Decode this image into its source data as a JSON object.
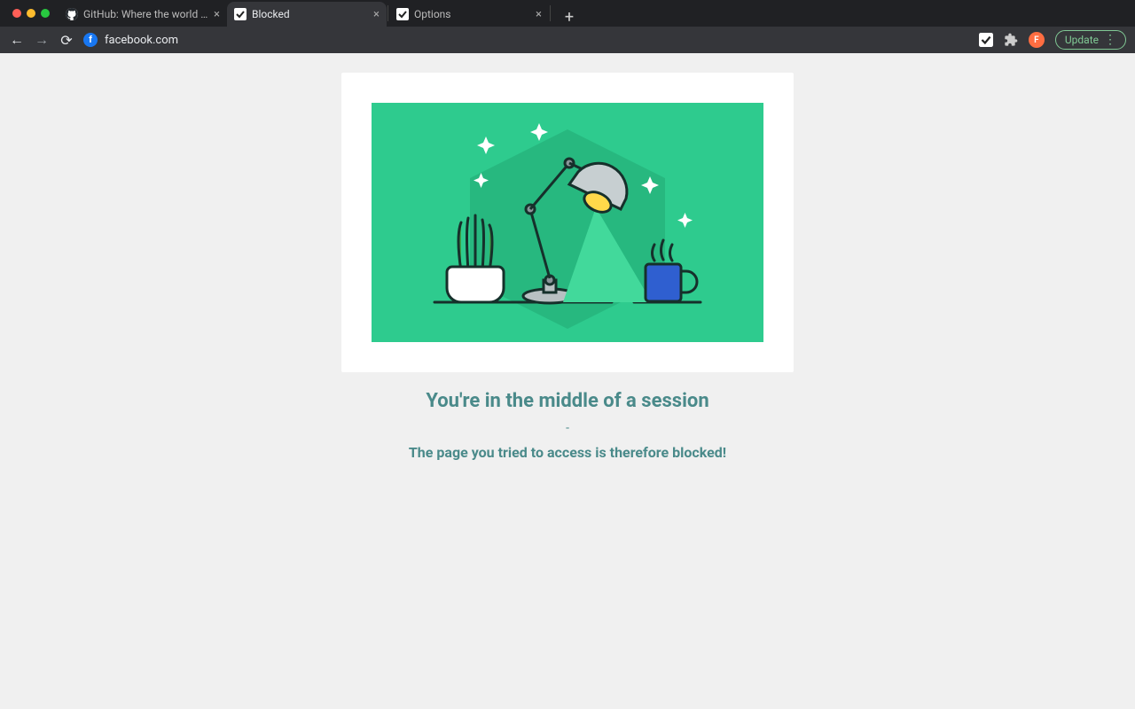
{
  "browser": {
    "tabs": [
      {
        "title": "GitHub: Where the world build…",
        "active": false,
        "favicon": "github"
      },
      {
        "title": "Blocked",
        "active": true,
        "favicon": "ext"
      },
      {
        "title": "Options",
        "active": false,
        "favicon": "ext"
      }
    ],
    "address": "facebook.com",
    "site_badge_letter": "f",
    "profile_letter": "F",
    "update_label": "Update"
  },
  "page": {
    "heading": "You're in the middle of a session",
    "separator": "-",
    "subheading": "The page you tried to access is therefore blocked!"
  },
  "colors": {
    "hero_bg": "#2ecb8e",
    "text": "#4a8a8a"
  }
}
